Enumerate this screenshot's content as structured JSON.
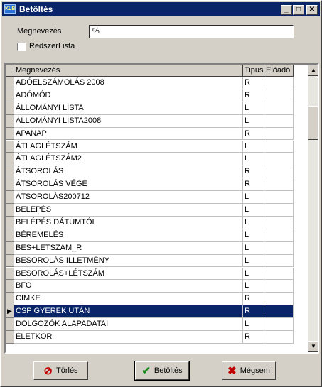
{
  "window": {
    "title": "Betöltés",
    "app_icon_text": "KLB"
  },
  "form": {
    "name_label": "Megnevezés",
    "name_value": "%",
    "checkbox_label": "RedszerLista"
  },
  "grid": {
    "columns": [
      "Megnevezés",
      "Tipus",
      "Előadó"
    ],
    "selected_index": 18,
    "rows": [
      {
        "name": "ADÓELSZÁMOLÁS 2008",
        "type": "R",
        "presenter": ""
      },
      {
        "name": "ADÓMÓD",
        "type": "R",
        "presenter": ""
      },
      {
        "name": "ÁLLOMÁNYI LISTA",
        "type": "L",
        "presenter": ""
      },
      {
        "name": "ÁLLOMÁNYI LISTA2008",
        "type": "L",
        "presenter": ""
      },
      {
        "name": "APANAP",
        "type": "R",
        "presenter": ""
      },
      {
        "name": "ÁTLAGLÉTSZÁM",
        "type": "L",
        "presenter": ""
      },
      {
        "name": "ÁTLAGLÉTSZÁM2",
        "type": "L",
        "presenter": ""
      },
      {
        "name": "ÁTSOROLÁS",
        "type": "R",
        "presenter": ""
      },
      {
        "name": "ÁTSOROLÁS VÉGE",
        "type": "R",
        "presenter": ""
      },
      {
        "name": "ÁTSOROLÁS200712",
        "type": "L",
        "presenter": ""
      },
      {
        "name": "BELÉPÉS",
        "type": "L",
        "presenter": ""
      },
      {
        "name": "BELÉPÉS DÁTUMTÓL",
        "type": "L",
        "presenter": ""
      },
      {
        "name": "BÉREMELÉS",
        "type": "L",
        "presenter": ""
      },
      {
        "name": "BES+LETSZAM_R",
        "type": "L",
        "presenter": ""
      },
      {
        "name": "BESOROLÁS ILLETMÉNY",
        "type": "L",
        "presenter": ""
      },
      {
        "name": "BESOROLÁS+LÉTSZÁM",
        "type": "L",
        "presenter": ""
      },
      {
        "name": "BFO",
        "type": "L",
        "presenter": ""
      },
      {
        "name": "CIMKE",
        "type": "R",
        "presenter": ""
      },
      {
        "name": "CSP GYEREK UTÁN",
        "type": "R",
        "presenter": ""
      },
      {
        "name": "DOLGOZÓK ALAPADATAI",
        "type": "L",
        "presenter": ""
      },
      {
        "name": "ÉLETKOR",
        "type": "R",
        "presenter": ""
      }
    ]
  },
  "buttons": {
    "delete": "Törlés",
    "load": "Betöltés",
    "cancel": "Mégsem"
  },
  "colors": {
    "title_bar": "#0a246a",
    "selection": "#0a246a",
    "face": "#d4d0c8"
  }
}
